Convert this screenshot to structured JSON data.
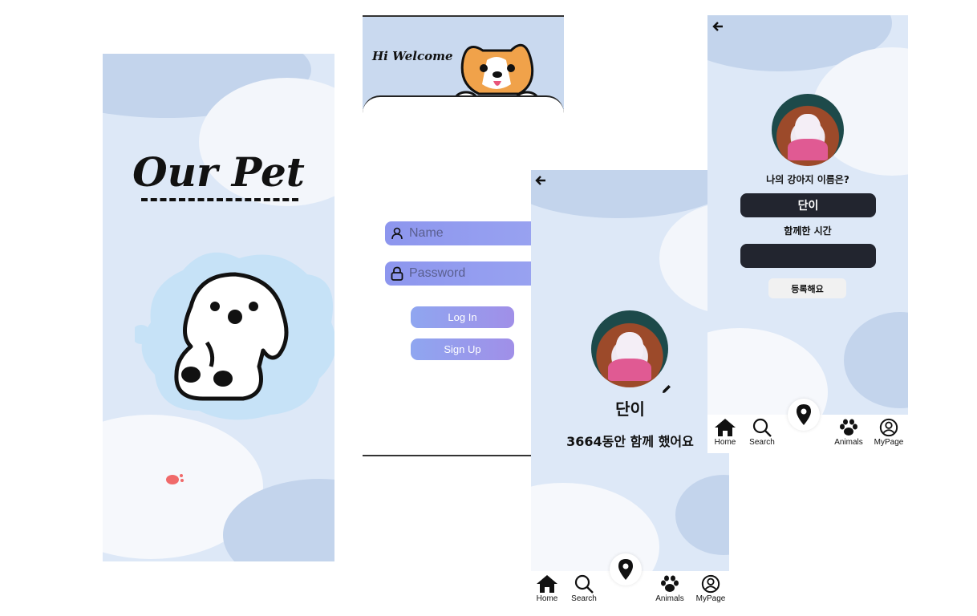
{
  "splash": {
    "title": "Our Pet"
  },
  "login": {
    "header_text": "Hi Welcome",
    "name_placeholder": "Name",
    "password_placeholder": "Password",
    "login_label": "Log In",
    "signup_label": "Sign Up"
  },
  "profile": {
    "pet_name": "단이",
    "days_text": "3664동안 함께 했어요"
  },
  "register": {
    "name_question": "나의 강아지 이름은?",
    "name_value": "단이",
    "time_question": "함께한 시간",
    "time_value": "",
    "submit_label": "등록해요"
  },
  "nav": {
    "home": "Home",
    "search": "Search",
    "animals": "Animals",
    "mypage": "MyPage"
  },
  "colors": {
    "background_blue": "#dde8f7",
    "field_purple": "#8d96ee",
    "dark_input": "#22252f",
    "paw_red": "#f06a6a"
  },
  "icons": [
    "person-icon",
    "lock-icon",
    "back-arrow-icon",
    "pencil-icon",
    "home-icon",
    "search-icon",
    "map-pin-icon",
    "paw-icon",
    "user-circle-icon"
  ]
}
